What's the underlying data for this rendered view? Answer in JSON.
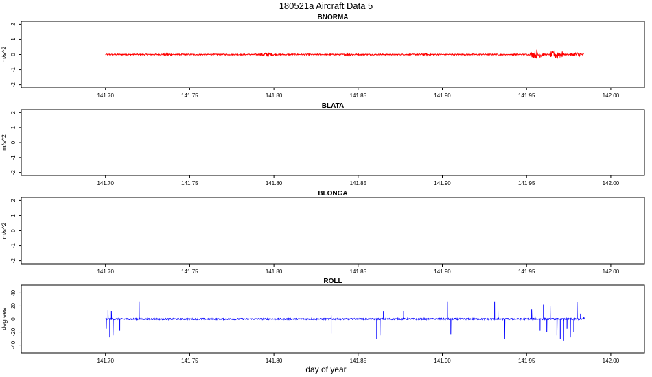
{
  "figure": {
    "title": "180521a   Aircraft Data 5",
    "xlabel": "day of year"
  },
  "chart_data": [
    {
      "type": "line",
      "title": "BNORMA",
      "ylabel": "m/s^2",
      "xlim": [
        141.65,
        142.02
      ],
      "ylim": [
        -2.2,
        2.2
      ],
      "yticks": [
        -2,
        -1,
        0,
        1,
        2
      ],
      "ytick_labels": [
        "-2",
        "-1",
        "0",
        "1",
        "2"
      ],
      "xticks": [
        141.7,
        141.75,
        141.8,
        141.85,
        141.9,
        141.95,
        142.0
      ],
      "xtick_labels": [
        "141.70",
        "141.75",
        "141.80",
        "141.85",
        "141.90",
        "141.95",
        "142.00"
      ],
      "series": [
        {
          "color": "#ff0000",
          "x_range": [
            141.7,
            141.984
          ],
          "baseline": 0,
          "noise_amplitude": 0.04,
          "bursts": [
            {
              "x": 141.737,
              "amplitude": 0.08
            },
            {
              "x": 141.796,
              "amplitude": 0.15
            },
            {
              "x": 141.845,
              "amplitude": 0.08
            },
            {
              "x": 141.89,
              "amplitude": 0.08
            },
            {
              "x": 141.956,
              "amplitude": 0.28
            },
            {
              "x": 141.968,
              "amplitude": 0.35
            },
            {
              "x": 141.98,
              "amplitude": 0.15
            }
          ]
        }
      ]
    },
    {
      "type": "line",
      "title": "BLATA",
      "ylabel": "m/s^2",
      "xlim": [
        141.65,
        142.02
      ],
      "ylim": [
        -2.2,
        2.2
      ],
      "yticks": [
        -2,
        -1,
        0,
        1,
        2
      ],
      "ytick_labels": [
        "-2",
        "-1",
        "0",
        "1",
        "2"
      ],
      "xticks": [
        141.7,
        141.75,
        141.8,
        141.85,
        141.9,
        141.95,
        142.0
      ],
      "xtick_labels": [
        "141.70",
        "141.75",
        "141.80",
        "141.85",
        "141.90",
        "141.95",
        "142.00"
      ],
      "series": []
    },
    {
      "type": "line",
      "title": "BLONGA",
      "ylabel": "m/s^2",
      "xlim": [
        141.65,
        142.02
      ],
      "ylim": [
        -2.2,
        2.2
      ],
      "yticks": [
        -2,
        -1,
        0,
        1,
        2
      ],
      "ytick_labels": [
        "-2",
        "-1",
        "0",
        "1",
        "2"
      ],
      "xticks": [
        141.7,
        141.75,
        141.8,
        141.85,
        141.9,
        141.95,
        142.0
      ],
      "xtick_labels": [
        "141.70",
        "141.75",
        "141.80",
        "141.85",
        "141.90",
        "141.95",
        "142.00"
      ],
      "series": []
    },
    {
      "type": "line",
      "title": "ROLL",
      "ylabel": "degrees",
      "xlim": [
        141.65,
        142.02
      ],
      "ylim": [
        -52,
        52
      ],
      "yticks": [
        -40,
        -20,
        0,
        20,
        40
      ],
      "ytick_labels": [
        "-40",
        "-20",
        "0",
        "20",
        "40"
      ],
      "xticks": [
        141.7,
        141.75,
        141.8,
        141.85,
        141.9,
        141.95,
        142.0
      ],
      "xtick_labels": [
        "141.70",
        "141.75",
        "141.80",
        "141.85",
        "141.90",
        "141.95",
        "142.00"
      ],
      "series": [
        {
          "color": "#0000ff",
          "x_range": [
            141.7,
            141.984
          ],
          "baseline": 0,
          "noise_amplitude": 1.0,
          "spikes": [
            {
              "x": 141.7005,
              "value": -15
            },
            {
              "x": 141.7015,
              "value": 14
            },
            {
              "x": 141.7025,
              "value": -28
            },
            {
              "x": 141.7035,
              "value": 13
            },
            {
              "x": 141.7045,
              "value": -25
            },
            {
              "x": 141.7085,
              "value": -18
            },
            {
              "x": 141.72,
              "value": 27
            },
            {
              "x": 141.834,
              "value": -22
            },
            {
              "x": 141.834,
              "value": 6
            },
            {
              "x": 141.861,
              "value": -30
            },
            {
              "x": 141.863,
              "value": -25
            },
            {
              "x": 141.865,
              "value": 12
            },
            {
              "x": 141.877,
              "value": 13
            },
            {
              "x": 141.903,
              "value": 27
            },
            {
              "x": 141.905,
              "value": -23
            },
            {
              "x": 141.931,
              "value": 27
            },
            {
              "x": 141.933,
              "value": 15
            },
            {
              "x": 141.937,
              "value": -30
            },
            {
              "x": 141.953,
              "value": 15
            },
            {
              "x": 141.955,
              "value": 5
            },
            {
              "x": 141.958,
              "value": -18
            },
            {
              "x": 141.96,
              "value": 22
            },
            {
              "x": 141.962,
              "value": -20
            },
            {
              "x": 141.964,
              "value": 20
            },
            {
              "x": 141.968,
              "value": -25
            },
            {
              "x": 141.97,
              "value": -30
            },
            {
              "x": 141.972,
              "value": -33
            },
            {
              "x": 141.974,
              "value": -15
            },
            {
              "x": 141.976,
              "value": -28
            },
            {
              "x": 141.978,
              "value": -20
            },
            {
              "x": 141.98,
              "value": 26
            },
            {
              "x": 141.982,
              "value": 8
            },
            {
              "x": 141.984,
              "value": 3
            }
          ]
        }
      ]
    }
  ]
}
